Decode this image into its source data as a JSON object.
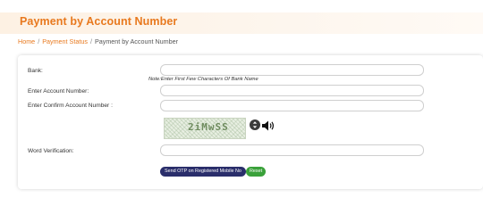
{
  "page": {
    "title": "Payment by Account Number"
  },
  "breadcrumb": {
    "home": "Home",
    "payment_status": "Payment Status",
    "current": "Payment by Account Number",
    "separator": "/"
  },
  "form": {
    "bank_label": "Bank:",
    "bank_value": "",
    "bank_note": "Note:Enter First Few Characters Of Bank Name",
    "account_label": "Enter Account Number:",
    "account_value": "",
    "confirm_label": "Enter Confirm Account Number :",
    "confirm_value": "",
    "captcha_text": "2iMwSS",
    "verification_label": "Word Verification:",
    "verification_value": "",
    "send_otp_label": "Send OTP on Registered Mobile No",
    "reset_label": "Reset"
  },
  "colors": {
    "accent": "#e8791e",
    "primary_button": "#2a2e6b",
    "reset_button": "#3aa13a"
  },
  "icons": {
    "refresh": "refresh-icon",
    "audio": "speaker-icon"
  }
}
